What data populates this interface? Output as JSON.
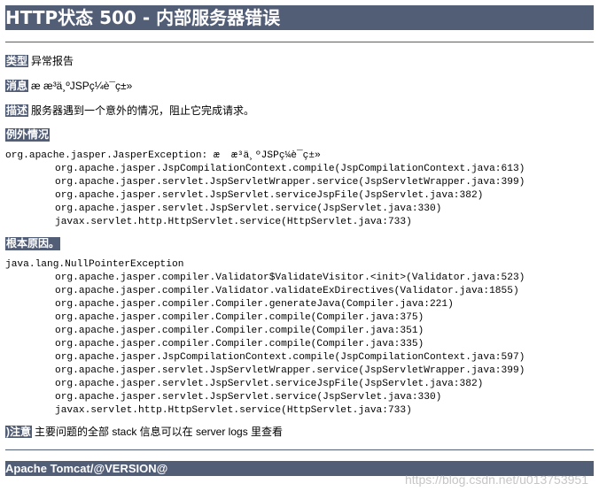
{
  "title": "HTTP状态 500 - 内部服务器错误",
  "type": {
    "label": "类型",
    "value": "异常报告"
  },
  "message": {
    "label": "消息",
    "value": "æ  æ³ä¸ºJSPç¼è¯ç±»"
  },
  "description": {
    "label": "描述",
    "value": "服务器遇到一个意外的情况，阻止它完成请求。"
  },
  "exception": {
    "label": "例外情况",
    "first_line": "org.apache.jasper.JasperException: æ  æ³ä¸ºJSPç¼è¯ç±»",
    "frames": [
      "org.apache.jasper.JspCompilationContext.compile(JspCompilationContext.java:613)",
      "org.apache.jasper.servlet.JspServletWrapper.service(JspServletWrapper.java:399)",
      "org.apache.jasper.servlet.JspServlet.serviceJspFile(JspServlet.java:382)",
      "org.apache.jasper.servlet.JspServlet.service(JspServlet.java:330)",
      "javax.servlet.http.HttpServlet.service(HttpServlet.java:733)"
    ]
  },
  "root_cause": {
    "label": "根本原因。",
    "first_line": "java.lang.NullPointerException",
    "frames": [
      "org.apache.jasper.compiler.Validator$ValidateVisitor.<init>(Validator.java:523)",
      "org.apache.jasper.compiler.Validator.validateExDirectives(Validator.java:1855)",
      "org.apache.jasper.compiler.Compiler.generateJava(Compiler.java:221)",
      "org.apache.jasper.compiler.Compiler.compile(Compiler.java:375)",
      "org.apache.jasper.compiler.Compiler.compile(Compiler.java:351)",
      "org.apache.jasper.compiler.Compiler.compile(Compiler.java:335)",
      "org.apache.jasper.JspCompilationContext.compile(JspCompilationContext.java:597)",
      "org.apache.jasper.servlet.JspServletWrapper.service(JspServletWrapper.java:399)",
      "org.apache.jasper.servlet.JspServlet.serviceJspFile(JspServlet.java:382)",
      "org.apache.jasper.servlet.JspServlet.service(JspServlet.java:330)",
      "javax.servlet.http.HttpServlet.service(HttpServlet.java:733)"
    ]
  },
  "note": {
    "label": ")注意",
    "value": "主要问题的全部 stack 信息可以在 server logs 里查看"
  },
  "footer": "Apache Tomcat/@VERSION@",
  "watermark": "https://blog.csdn.net/u013753951",
  "colors": {
    "accent": "#525d76",
    "text": "#000000",
    "background": "#ffffff"
  }
}
